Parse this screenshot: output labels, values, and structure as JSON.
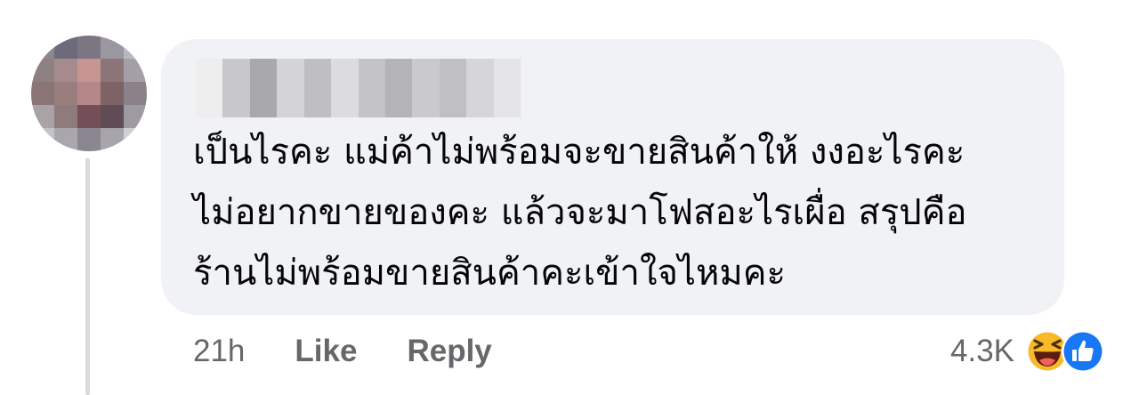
{
  "comment": {
    "author_name": "",
    "text": "เป็นไรคะ แม่ค้าไม่พร้อมจะขายสินค้าให้ งงอะไรคะ\nไม่อยากขายของคะ แล้วจะมาโฟสอะไรเผื่อ สรุปคือ\nร้านไม่พร้อมขายสินค้าคะเข้าใจไหมคะ",
    "timestamp": "21h",
    "like_label": "Like",
    "reply_label": "Reply",
    "reaction_count": "4.3K",
    "reaction_icons": [
      "haha-emoji-icon",
      "like-thumb-icon"
    ]
  },
  "colors": {
    "bubble_bg": "#f0f2f5",
    "text": "#050505",
    "secondary_text": "#65676b",
    "like_blue": "#1877f2",
    "haha_yellow": "#f7b928"
  }
}
